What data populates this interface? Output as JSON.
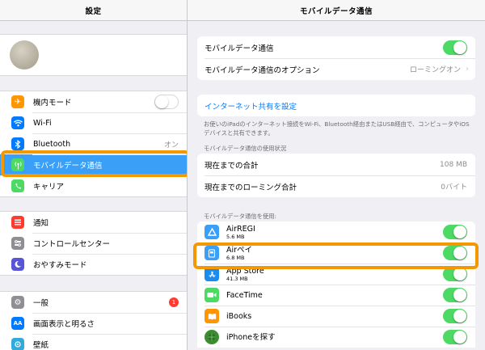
{
  "sidebar": {
    "title": "設定",
    "group1": [
      {
        "label": "機内モード",
        "icon": "airplane-icon",
        "color": "#ff9500",
        "control": "toggle-off"
      },
      {
        "label": "Wi-Fi",
        "icon": "wifi-icon",
        "color": "#007aff"
      },
      {
        "label": "Bluetooth",
        "icon": "bluetooth-icon",
        "color": "#007aff",
        "value": "オン"
      },
      {
        "label": "モバイルデータ通信",
        "icon": "antenna-icon",
        "color": "#4cd964",
        "selected": true
      },
      {
        "label": "キャリア",
        "icon": "phone-icon",
        "color": "#4cd964"
      }
    ],
    "group2": [
      {
        "label": "通知",
        "icon": "notifications-icon",
        "color": "#ff3b30"
      },
      {
        "label": "コントロールセンター",
        "icon": "control-center-icon",
        "color": "#8e8e93"
      },
      {
        "label": "おやすみモード",
        "icon": "moon-icon",
        "color": "#5856d6"
      }
    ],
    "group3": [
      {
        "label": "一般",
        "icon": "gear-icon",
        "color": "#8e8e93",
        "badge": "1"
      },
      {
        "label": "画面表示と明るさ",
        "icon": "display-icon",
        "color": "#007aff"
      },
      {
        "label": "壁紙",
        "icon": "wallpaper-icon",
        "color": "#34aadc"
      }
    ]
  },
  "detail": {
    "title": "モバイルデータ通信",
    "cellular_label": "モバイルデータ通信",
    "options_label": "モバイルデータ通信のオプション",
    "options_value": "ローミングオン",
    "hotspot_link": "インターネット共有を設定",
    "hotspot_note": "お使いのiPadのインターネット接続をWi-Fi、Bluetooth経由またはUSB経由で、コンピュータやiOSデバイスと共有できます。",
    "usage_header": "モバイルデータ通信の使用状況",
    "current_label": "現在までの合計",
    "current_value": "108 MB",
    "roaming_label": "現在までのローミング合計",
    "roaming_value": "0バイト",
    "apps_header": "モバイルデータ通信を使用:",
    "apps": [
      {
        "name": "AirREGI",
        "size": "5.6 MB",
        "icon": "airregi-icon",
        "color": "#3a9ff7"
      },
      {
        "name": "Airペイ",
        "size": "6.8 MB",
        "icon": "airpay-icon",
        "color": "#3a9ff7"
      },
      {
        "name": "App Store",
        "size": "41.3 MB",
        "icon": "app-store-icon",
        "color": "#1a8cf0"
      },
      {
        "name": "FaceTime",
        "size": "",
        "icon": "facetime-icon",
        "color": "#4cd964"
      },
      {
        "name": "iBooks",
        "size": "",
        "icon": "ibooks-icon",
        "color": "#ff9500"
      },
      {
        "name": "iPhoneを探す",
        "size": "",
        "icon": "find-iphone-icon",
        "color": "#3c8d2f"
      }
    ]
  }
}
